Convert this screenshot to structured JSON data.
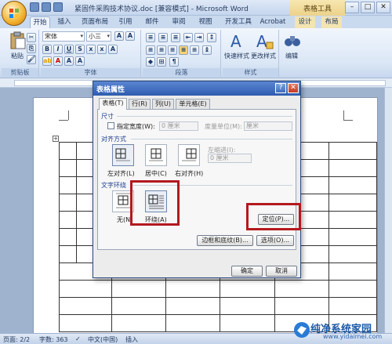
{
  "window": {
    "title": "紧固件采购技术协议.doc [兼容模式] - Microsoft Word",
    "context_tab_title": "表格工具"
  },
  "ribbon_tabs": [
    "开始",
    "插入",
    "页面布局",
    "引用",
    "邮件",
    "审阅",
    "视图",
    "开发工具",
    "Acrobat",
    "设计",
    "布局"
  ],
  "ribbon": {
    "paste_label": "粘贴",
    "font_name": "宋体",
    "font_size": "小三",
    "quick_styles_label": "快速样式",
    "change_styles_label": "更改样式",
    "edit_label": "编辑",
    "groups": {
      "clipboard": "剪贴板",
      "font": "字体",
      "paragraph": "段落",
      "styles": "样式"
    }
  },
  "dialog": {
    "title": "表格属性",
    "help": "?",
    "close": "✕",
    "tabs": [
      "表格(T)",
      "行(R)",
      "列(U)",
      "单元格(E)"
    ],
    "size_section": "尺寸",
    "preferred_width_label": "指定宽度(W):",
    "preferred_width_value": "0 厘米",
    "measure_label": "度量单位(M):",
    "measure_value": "厘米",
    "alignment_section": "对齐方式",
    "align_left": "左对齐(L)",
    "align_center": "居中(C)",
    "align_right": "右对齐(H)",
    "indent_label": "左缩进(I):",
    "indent_value": "0 厘米",
    "wrapping_section": "文字环绕",
    "wrap_none": "无(N)",
    "wrap_around": "环绕(A)",
    "positioning_button": "定位(P)...",
    "borders_button": "边框和底纹(B)...",
    "options_button": "选项(O)...",
    "ok_button": "确定",
    "cancel_button": "取消"
  },
  "status": {
    "page": "页面: 2/2",
    "words": "字数: 363",
    "language": "中文(中国)",
    "insert_mode": "插入"
  },
  "watermark": {
    "text": "纯净系统家园",
    "url": "www.yidaimei.com"
  },
  "colors": {
    "highlight": "#b3191e",
    "dialog_title": "#2f5cb0",
    "ribbon_bg": "#dbe7f6"
  }
}
